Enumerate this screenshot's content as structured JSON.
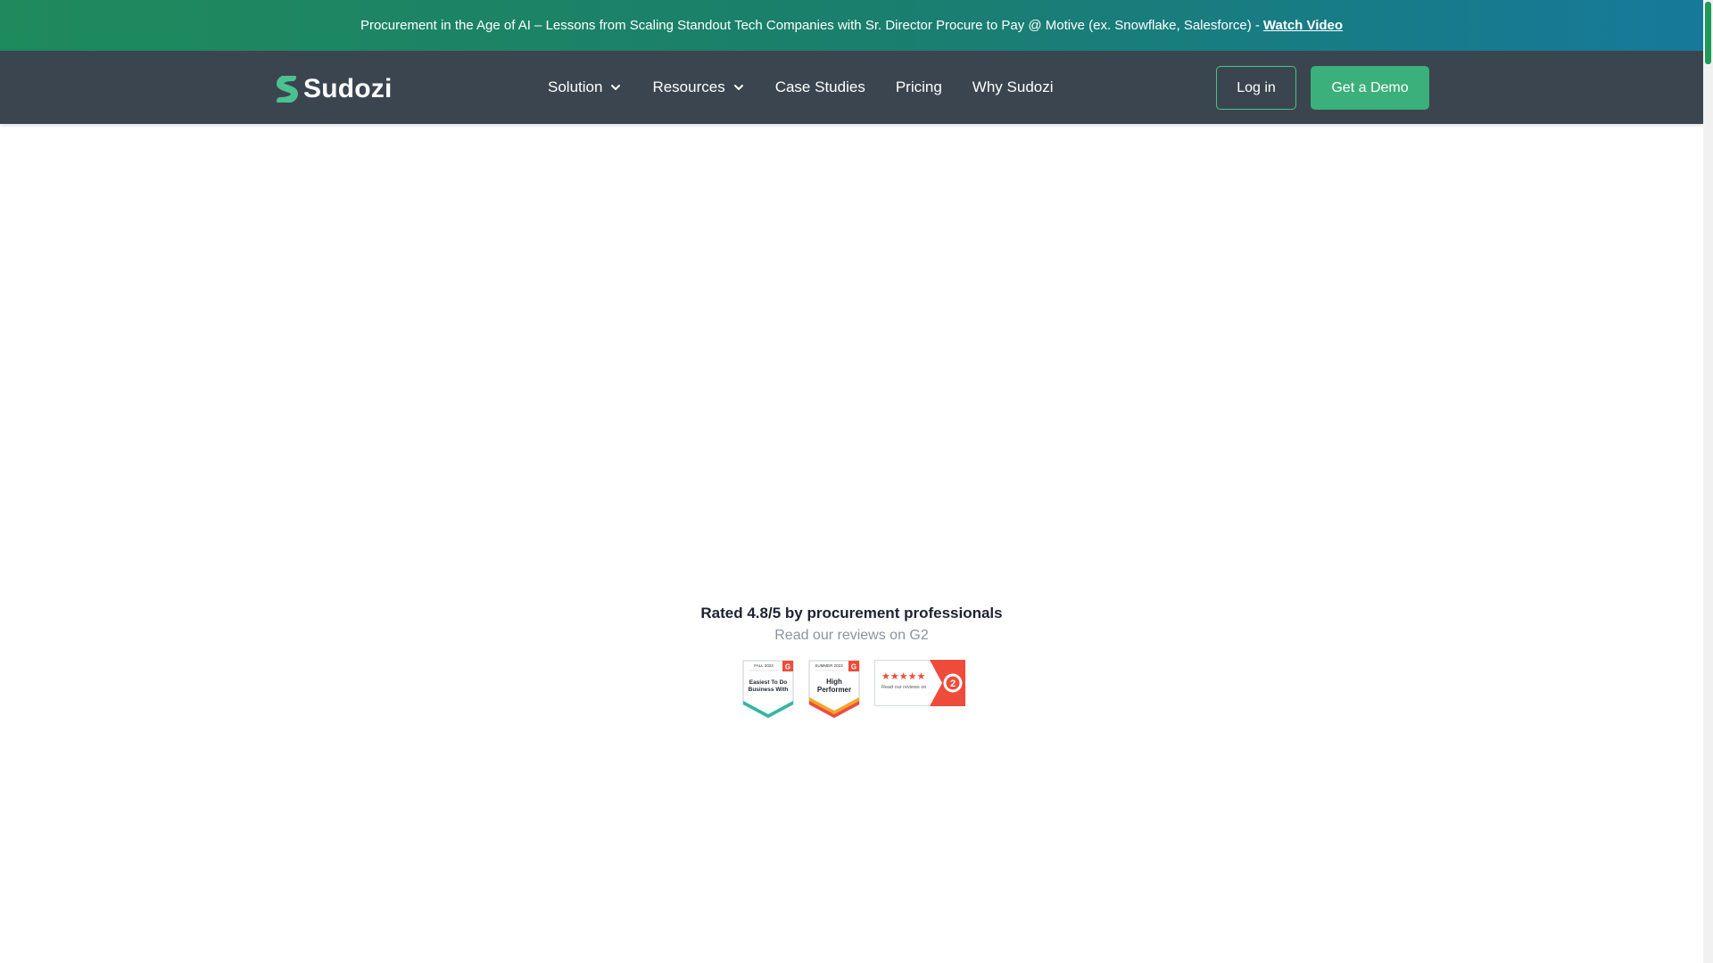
{
  "announcement": {
    "text": "Procurement in the Age of AI – Lessons from Scaling Standout Tech Companies with Sr. Director Procure to Pay @ Motive (ex. Snowflake, Salesforce) -",
    "link_label": "Watch Video"
  },
  "header": {
    "logo_text": "Sudozi",
    "nav": [
      {
        "label": "Solution",
        "has_dropdown": true
      },
      {
        "label": "Resources",
        "has_dropdown": true
      },
      {
        "label": "Case Studies",
        "has_dropdown": false
      },
      {
        "label": "Pricing",
        "has_dropdown": false
      },
      {
        "label": "Why Sudozi",
        "has_dropdown": false
      }
    ],
    "login_label": "Log in",
    "demo_label": "Get a Demo"
  },
  "rating": {
    "title": "Rated 4.8/5 by procurement professionals",
    "subtitle": "Read our reviews on G2",
    "badges": {
      "easiest": {
        "season": "FALL 2023",
        "line1": "Easiest To Do",
        "line2": "Business With"
      },
      "performer": {
        "season": "SUMMER 2023",
        "line1": "High",
        "line2": "Performer"
      },
      "reviews": {
        "stars": "★★★★★",
        "label": "Read our reviews on"
      }
    }
  },
  "colors": {
    "banner_start": "#1f8a5c",
    "banner_end": "#17799a",
    "header_bg": "#3b4550",
    "accent_green": "#3bb07a",
    "g2_red": "#ef4b3b"
  }
}
